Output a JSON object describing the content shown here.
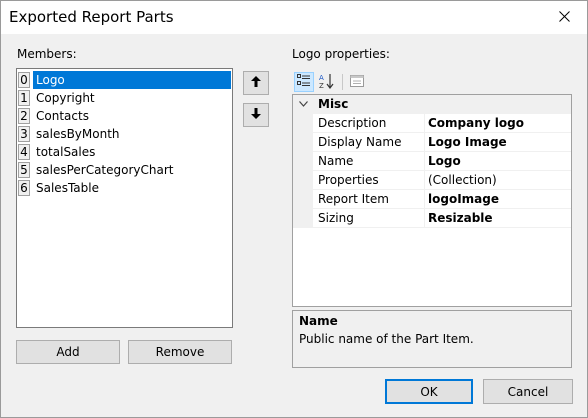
{
  "window": {
    "title": "Exported Report Parts"
  },
  "members": {
    "label": "Members:",
    "items": [
      {
        "index": "0",
        "name": "Logo"
      },
      {
        "index": "1",
        "name": "Copyright"
      },
      {
        "index": "2",
        "name": "Contacts"
      },
      {
        "index": "3",
        "name": "salesByMonth"
      },
      {
        "index": "4",
        "name": "totalSales"
      },
      {
        "index": "5",
        "name": "salesPerCategoryChart"
      },
      {
        "index": "6",
        "name": "SalesTable"
      }
    ],
    "selected_index": 0,
    "add_label": "Add",
    "remove_label": "Remove"
  },
  "properties": {
    "label": "Logo properties:",
    "category": "Misc",
    "rows": [
      {
        "name": "Description",
        "value": "Company logo",
        "bold": true
      },
      {
        "name": "Display Name",
        "value": "Logo Image",
        "bold": true
      },
      {
        "name": "Name",
        "value": "Logo",
        "bold": true
      },
      {
        "name": "Properties",
        "value": "(Collection)",
        "bold": false
      },
      {
        "name": "Report Item",
        "value": "logoImage",
        "bold": true
      },
      {
        "name": "Sizing",
        "value": "Resizable",
        "bold": true
      }
    ],
    "description_title": "Name",
    "description_text": "Public name of the Part Item."
  },
  "footer": {
    "ok_label": "OK",
    "cancel_label": "Cancel"
  },
  "icons": {
    "close": "close-icon",
    "move_up": "arrow-up-icon",
    "move_down": "arrow-down-icon",
    "categorized": "categorized-icon",
    "alphabetical": "sort-alphabetical-icon",
    "property_pages": "property-pages-icon"
  },
  "colors": {
    "selection": "#0078d7",
    "accent_border": "#0078d7"
  }
}
